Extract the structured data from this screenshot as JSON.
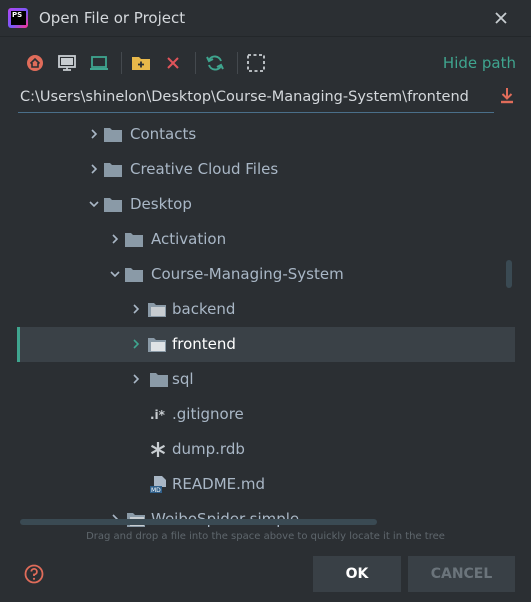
{
  "window": {
    "title": "Open File or Project",
    "logo_text": "PS"
  },
  "toolbar": {
    "icons": [
      "home-icon",
      "desktop-icon",
      "project-icon",
      "new-folder-icon",
      "delete-icon",
      "refresh-icon",
      "select-icon"
    ],
    "hide_path_label": "Hide path"
  },
  "path": {
    "value": "C:\\Users\\shinelon\\Desktop\\Course-Managing-System\\frontend"
  },
  "tree": {
    "items": [
      {
        "label": "Contacts",
        "type": "folder",
        "expanded": false
      },
      {
        "label": "Creative Cloud Files",
        "type": "folder",
        "expanded": false
      },
      {
        "label": "Desktop",
        "type": "folder",
        "expanded": true
      },
      {
        "label": "Activation",
        "type": "folder",
        "expanded": false
      },
      {
        "label": "Course-Managing-System",
        "type": "folder",
        "expanded": true
      },
      {
        "label": "backend",
        "type": "module-folder",
        "expanded": false
      },
      {
        "label": "frontend",
        "type": "module-folder",
        "expanded": false,
        "selected": true
      },
      {
        "label": "sql",
        "type": "folder",
        "expanded": false
      },
      {
        "label": ".gitignore",
        "type": "gitignore-file"
      },
      {
        "label": "dump.rdb",
        "type": "rdb-file"
      },
      {
        "label": "README.md",
        "type": "markdown-file"
      },
      {
        "label": "WeiboSpider-simple",
        "type": "module-folder",
        "expanded": false
      }
    ]
  },
  "hint": "Drag and drop a file into the space above to quickly locate it in the tree",
  "buttons": {
    "ok": "OK",
    "cancel": "CANCEL"
  },
  "colors": {
    "accent": "#3fa58f",
    "background": "#2b2f33",
    "selection": "#3a4147"
  }
}
